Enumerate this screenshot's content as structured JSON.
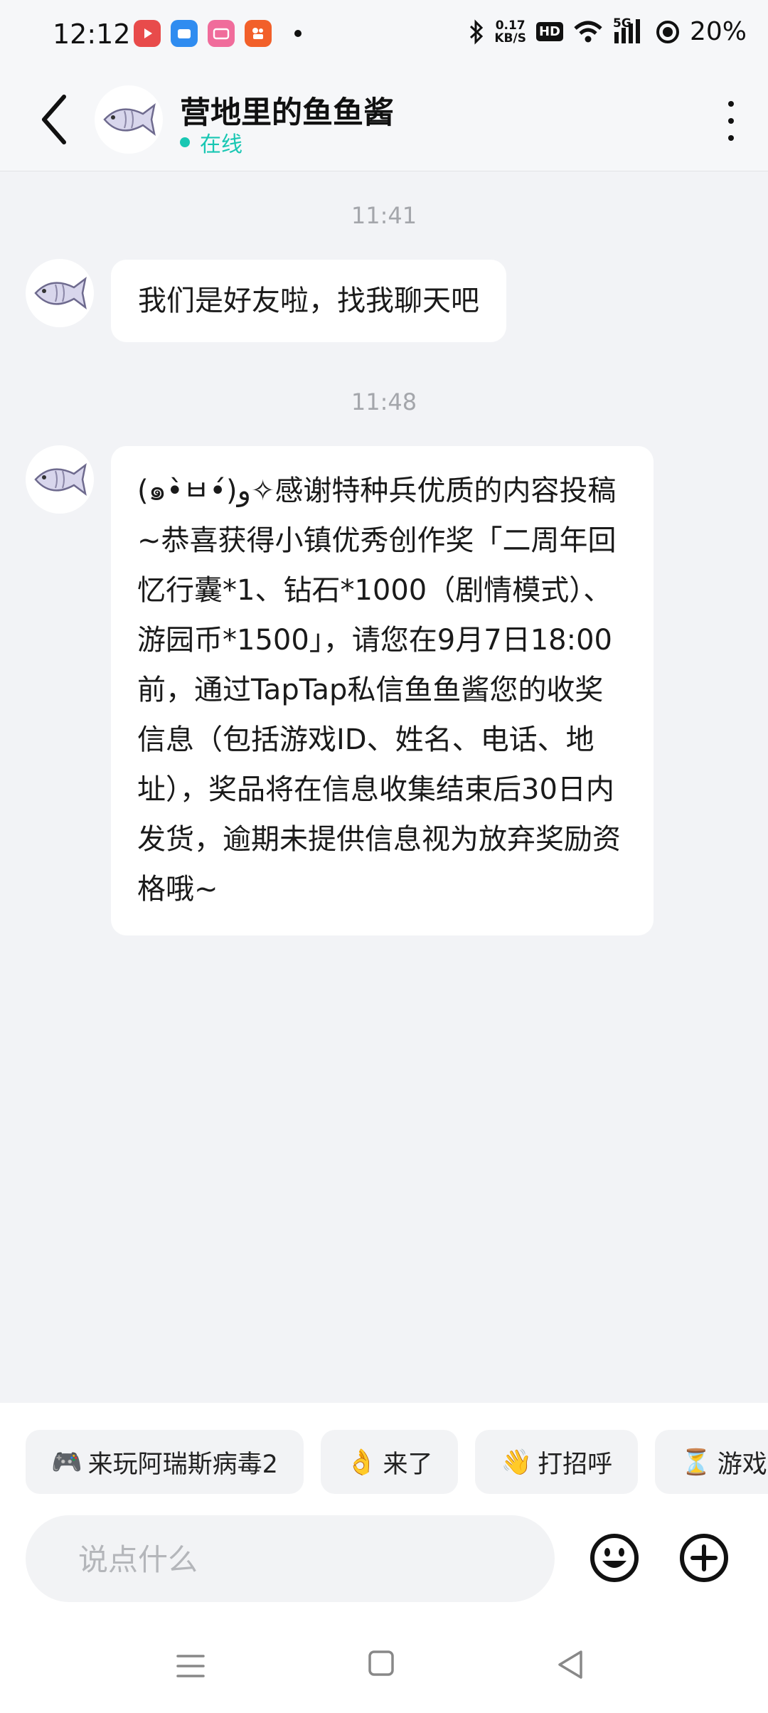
{
  "status_bar": {
    "time": "12:12",
    "net_speed_value": "0.17",
    "net_speed_unit": "KB/S",
    "hd": "HD",
    "network": "5G",
    "battery": "20%"
  },
  "header": {
    "contact_name": "营地里的鱼鱼酱",
    "status": "在线"
  },
  "messages": [
    {
      "time": "11:41",
      "text": "我们是好友啦，找我聊天吧"
    },
    {
      "time": "11:48",
      "text": "(๑•̀ㅂ•́)و✧感谢特种兵优质的内容投稿~恭喜获得小镇优秀创作奖「二周年回忆行囊*1、钻石*1000（剧情模式）、游园币*1500」，请您在9月7日18:00前，通过TapTap私信鱼鱼酱您的收奖信息（包括游戏ID、姓名、电话、地址），奖品将在信息收集结束后30日内发货，逾期未提供信息视为放弃奖励资格哦~"
    }
  ],
  "quick_replies": [
    {
      "emoji": "🎮",
      "label": "来玩阿瑞斯病毒2"
    },
    {
      "emoji": "👌",
      "label": "来了"
    },
    {
      "emoji": "👋",
      "label": "打招呼"
    },
    {
      "emoji": "⏳",
      "label": "游戏中"
    }
  ],
  "composer": {
    "placeholder": "说点什么"
  },
  "colors": {
    "online": "#19c7b3",
    "background": "#f2f3f6"
  }
}
